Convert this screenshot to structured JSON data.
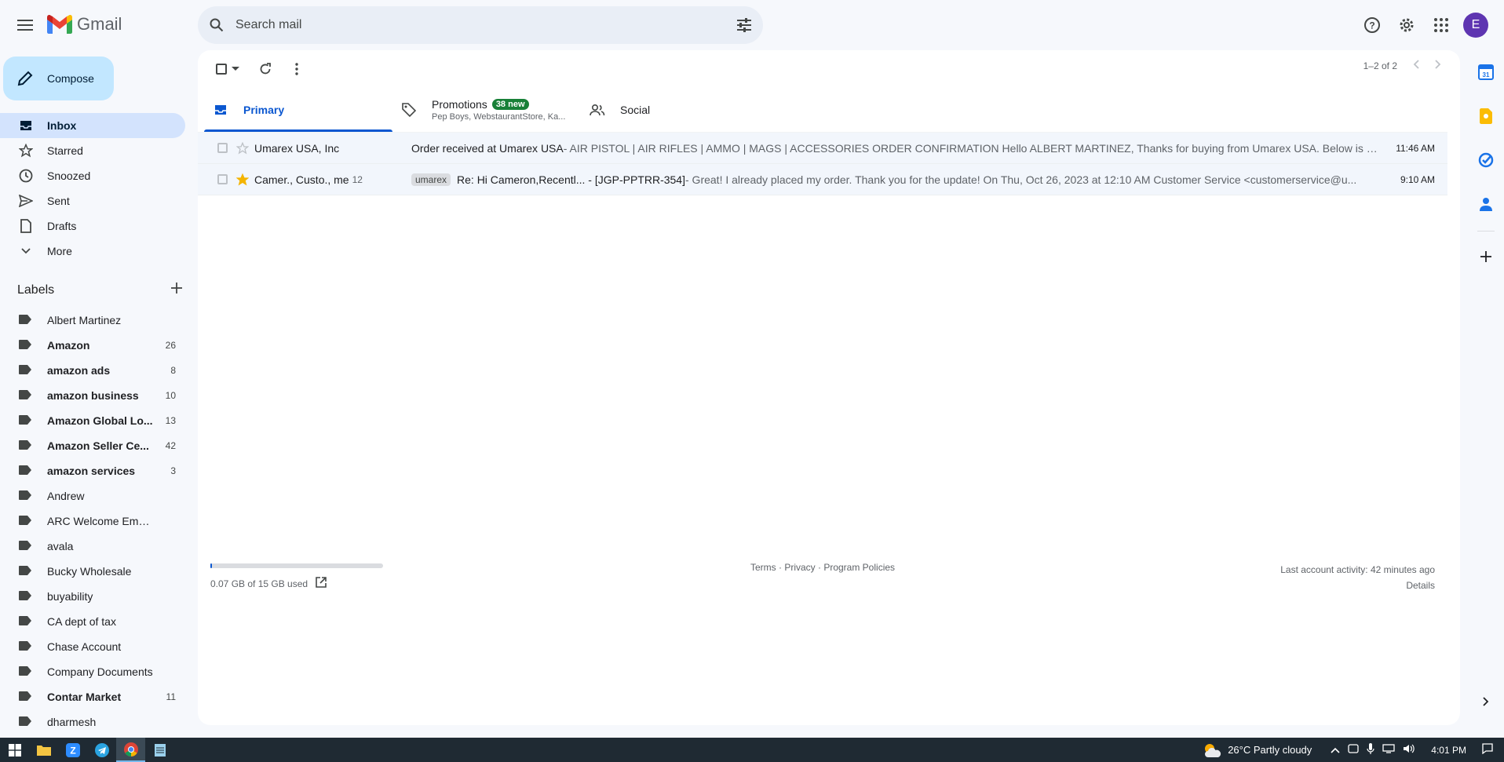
{
  "header": {
    "app_name": "Gmail",
    "search_placeholder": "Search mail",
    "avatar_letter": "E"
  },
  "sidebar": {
    "compose_label": "Compose",
    "nav": [
      {
        "label": "Inbox",
        "icon": "inbox-icon",
        "active": true
      },
      {
        "label": "Starred",
        "icon": "star-icon"
      },
      {
        "label": "Snoozed",
        "icon": "clock-icon"
      },
      {
        "label": "Sent",
        "icon": "send-icon"
      },
      {
        "label": "Drafts",
        "icon": "draft-icon"
      },
      {
        "label": "More",
        "icon": "chevron-down-icon"
      }
    ],
    "labels_title": "Labels",
    "labels": [
      {
        "name": "Albert Martinez",
        "count": "",
        "bold": false
      },
      {
        "name": "Amazon",
        "count": "26",
        "bold": true
      },
      {
        "name": "amazon ads",
        "count": "8",
        "bold": true
      },
      {
        "name": "amazon business",
        "count": "10",
        "bold": true
      },
      {
        "name": "Amazon Global Lo...",
        "count": "13",
        "bold": true
      },
      {
        "name": "Amazon Seller Ce...",
        "count": "42",
        "bold": true
      },
      {
        "name": "amazon services",
        "count": "3",
        "bold": true
      },
      {
        "name": "Andrew",
        "count": "",
        "bold": false
      },
      {
        "name": "ARC Welcome Emails",
        "count": "",
        "bold": false
      },
      {
        "name": "avala",
        "count": "",
        "bold": false
      },
      {
        "name": "Bucky Wholesale",
        "count": "",
        "bold": false
      },
      {
        "name": "buyability",
        "count": "",
        "bold": false
      },
      {
        "name": "CA dept of tax",
        "count": "",
        "bold": false
      },
      {
        "name": "Chase Account",
        "count": "",
        "bold": false
      },
      {
        "name": "Company Documents",
        "count": "",
        "bold": false
      },
      {
        "name": "Contar Market",
        "count": "11",
        "bold": true
      },
      {
        "name": "dharmesh",
        "count": "",
        "bold": false
      }
    ]
  },
  "toolbar": {
    "pager_text": "1–2 of 2"
  },
  "tabs": [
    {
      "label": "Primary",
      "icon": "inbox-icon",
      "active": true
    },
    {
      "label": "Promotions",
      "icon": "tag-icon",
      "badge": "38 new",
      "sub": "Pep Boys, WebstaurantStore, Ka..."
    },
    {
      "label": "Social",
      "icon": "people-icon"
    }
  ],
  "emails": [
    {
      "sender": "Umarex USA, Inc",
      "count": "",
      "starred": false,
      "chip": "",
      "subject": "Order received at Umarex USA",
      "snippet": " - AIR PISTOL | AIR RIFLES | AMMO | MAGS | ACCESSORIES ORDER CONFIRMATION Hello ALBERT MARTINEZ, Thanks for buying from Umarex USA. Below is th...",
      "time": "11:46 AM"
    },
    {
      "sender": "Camer., Custo., me",
      "count": "12",
      "starred": true,
      "chip": "umarex",
      "subject": "Re: Hi Cameron,Recentl... - [JGP-PPTRR-354]",
      "snippet": " - Great! I already placed my order. Thank you for the update! On Thu, Oct 26, 2023 at 12:10 AM Customer Service <customerservice@u...",
      "time": "9:10 AM"
    }
  ],
  "footer": {
    "storage_text": "0.07 GB of 15 GB used",
    "storage_fraction": 0.005,
    "links": "Terms · Privacy · Program Policies",
    "activity": "Last account activity: 42 minutes ago",
    "details": "Details"
  },
  "taskbar": {
    "weather": "26°C  Partly cloudy",
    "time": "4:01 PM"
  },
  "colors": {
    "compose_bg": "#c2e7ff",
    "active_nav": "#d3e3fd",
    "primary_blue": "#0b57d0",
    "badge_green": "#188038",
    "star_yellow": "#f4b400",
    "avatar": "#5e35b1"
  }
}
